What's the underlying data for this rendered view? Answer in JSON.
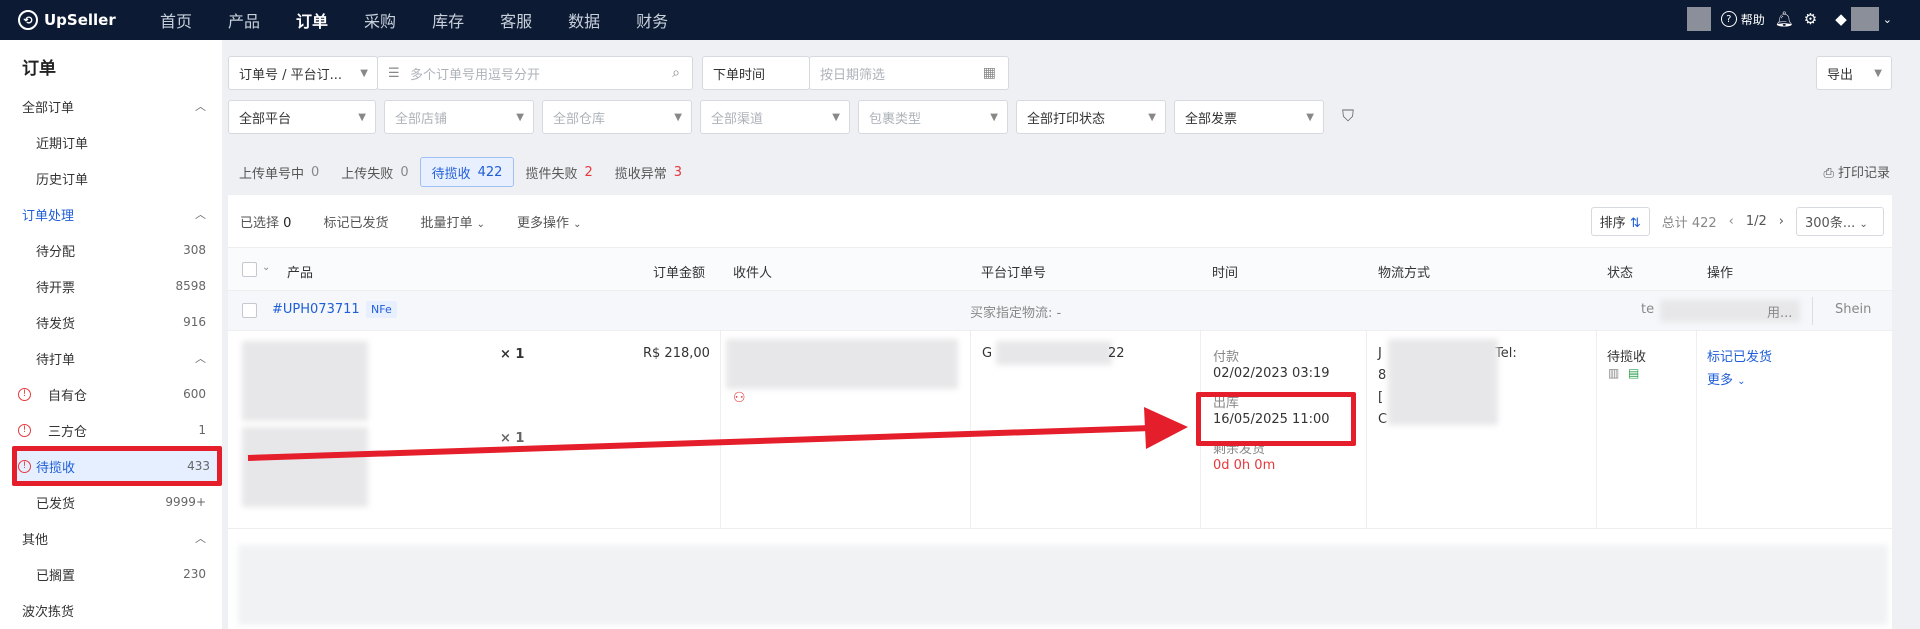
{
  "app": {
    "logo_text": "UpSeller",
    "logo_icon": "upseller-logo-icon"
  },
  "nav": [
    {
      "label": "首页",
      "active": false
    },
    {
      "label": "产品",
      "active": false
    },
    {
      "label": "订单",
      "active": true
    },
    {
      "label": "采购",
      "active": false
    },
    {
      "label": "库存",
      "active": false
    },
    {
      "label": "客服",
      "active": false
    },
    {
      "label": "数据",
      "active": false
    },
    {
      "label": "财务",
      "active": false
    }
  ],
  "topright": {
    "help_label": "帮助"
  },
  "sidebar": {
    "title": "订单",
    "all_orders": "全部订单",
    "recent": "近期订单",
    "history": "历史订单",
    "processing": "订单处理",
    "to_assign": {
      "label": "待分配",
      "count": "308"
    },
    "to_invoice": {
      "label": "待开票",
      "count": "8598"
    },
    "to_ship": {
      "label": "待发货",
      "count": "916"
    },
    "to_print": "待打单",
    "own_wh": {
      "label": "自有仓",
      "count": "600"
    },
    "third_wh": {
      "label": "三方仓",
      "count": "1"
    },
    "to_pickup": {
      "label": "待揽收",
      "count": "433"
    },
    "shipped": {
      "label": "已发货",
      "count": "9999+"
    },
    "other": "其他",
    "on_hold": {
      "label": "已搁置",
      "count": "230"
    },
    "wave": "波次拣货"
  },
  "filters": {
    "order_type": "订单号 / 平台订...",
    "order_placeholder": "多个订单号用逗号分开",
    "time_type": "下单时间",
    "date_placeholder": "按日期筛选",
    "export": "导出",
    "platform": "全部平台",
    "store": "全部店铺",
    "warehouse": "全部仓库",
    "channel": "全部渠道",
    "package": "包裹类型",
    "print_status": "全部打印状态",
    "invoice": "全部发票"
  },
  "tabs": [
    {
      "label": "上传单号中",
      "count": "0",
      "red": false,
      "active": false
    },
    {
      "label": "上传失败",
      "count": "0",
      "red": false,
      "active": false
    },
    {
      "label": "待揽收",
      "count": "422",
      "red": false,
      "active": true
    },
    {
      "label": "揽件失败",
      "count": "2",
      "red": true,
      "active": false
    },
    {
      "label": "揽收异常",
      "count": "3",
      "red": true,
      "active": false
    }
  ],
  "print_records": "打印记录",
  "toolbar": {
    "selected_label": "已选择",
    "selected_count": "0",
    "mark_shipped": "标记已发货",
    "batch_print": "批量打单",
    "more_ops": "更多操作",
    "sort": "排序",
    "total": "总计 422",
    "page": "1/2",
    "per_page": "300条..."
  },
  "columns": {
    "product": "产品",
    "amount": "订单金额",
    "receiver": "收件人",
    "platform_no": "平台订单号",
    "time": "时间",
    "logistics": "物流方式",
    "status": "状态",
    "actions": "操作"
  },
  "order": {
    "id": "#UPH073711",
    "badge": "NFe",
    "buyer_logistics": "买家指定物流: -",
    "store_prefix": "te",
    "store_suffix": "用...",
    "platform": "Shein",
    "qty1": "× 1",
    "qty2": "× 1",
    "amount": "R$ 218,00",
    "platform_no_prefix": "G",
    "platform_no_suffix": "22",
    "paid_label": "付款",
    "paid_time": "02/02/2023 03:19",
    "out_label": "出库",
    "out_time": "16/05/2025 11:00",
    "remaining_label": "剩余发货",
    "remaining_value": "0d 0h 0m",
    "logistics_prefix": "J",
    "logistics_tel": "Tel:",
    "logistics_l2": "8",
    "logistics_l3": "[",
    "logistics_l4": "C",
    "status": "待揽收",
    "action_mark": "标记已发货",
    "action_more": "更多"
  },
  "colors": {
    "topbar": "#0c1b33",
    "accent": "#1f5ed8",
    "annotation": "#e41e2a",
    "warning": "#e5393d"
  }
}
